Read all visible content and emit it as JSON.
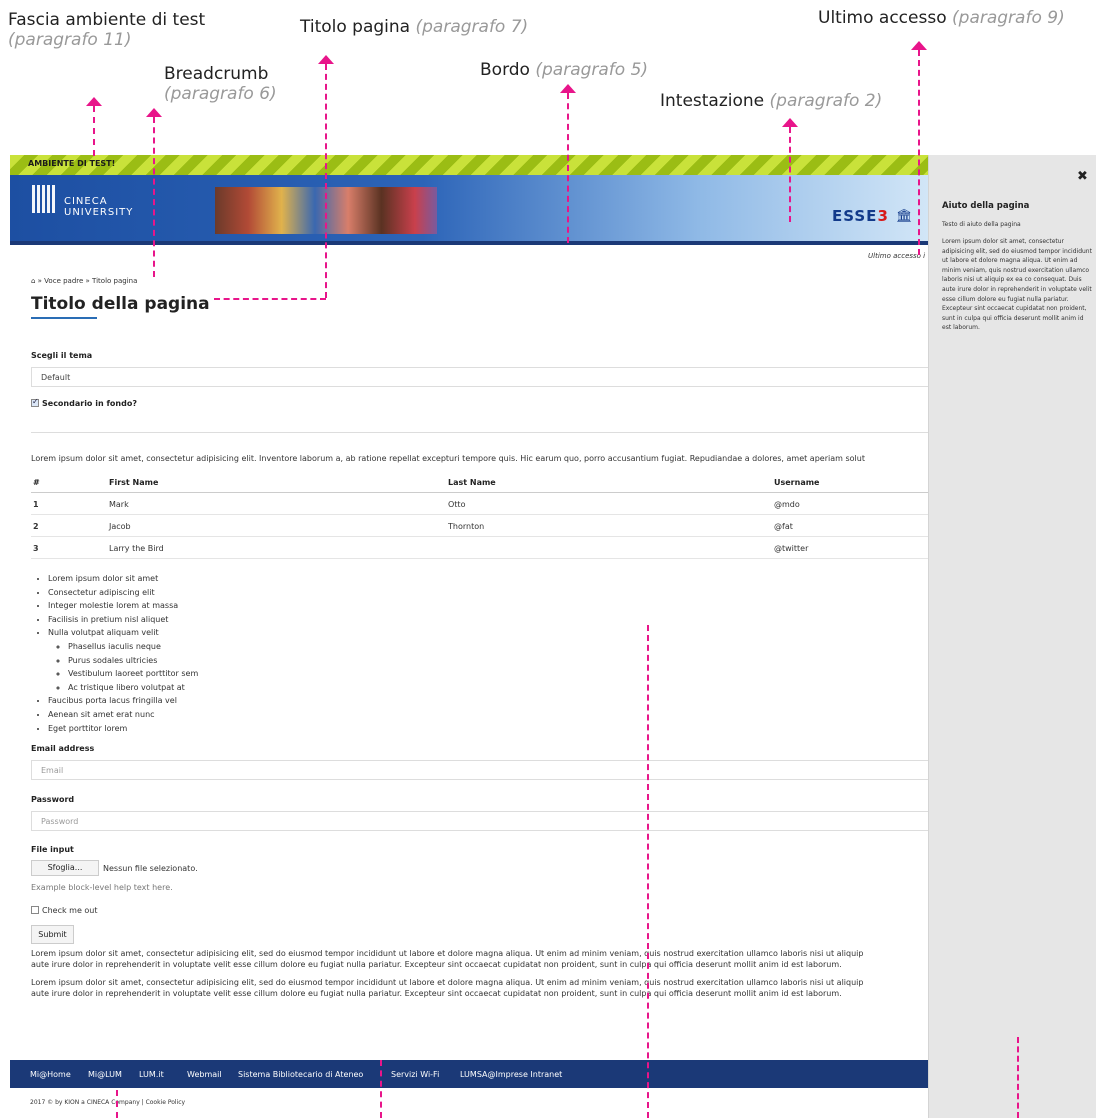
{
  "annotations": {
    "fascia": {
      "main": "Fascia ambiente di test",
      "para": "(paragrafo 11)"
    },
    "titolo": {
      "main": "Titolo pagina ",
      "para": "(paragrafo 7)"
    },
    "ultimo": {
      "main": "Ultimo accesso ",
      "para": "(paragrafo 9)"
    },
    "breadcrumb": {
      "main": "Breadcrumb",
      "para": "(paragrafo 6)"
    },
    "bordo": {
      "main": "Bordo ",
      "para": "(paragrafo 5)"
    },
    "intestazione": {
      "main": "Intestazione ",
      "para": "(paragrafo 2)"
    }
  },
  "testband": {
    "label": "AMBIENTE DI TEST!"
  },
  "header": {
    "logo_line1": "CINECA",
    "logo_line2": "UNIVERSITY",
    "brand_pre": "ESSE",
    "brand_num": "3"
  },
  "last_access": "Ultimo accesso i",
  "breadcrumb": {
    "home_icon": "home-icon",
    "text": " » Voce padre » Titolo pagina"
  },
  "page_title": "Titolo della pagina",
  "theme": {
    "label": "Scegli il tema",
    "value": "Default"
  },
  "secondary": {
    "label": "Secondario in fondo?",
    "checked": true
  },
  "intro": "Lorem ipsum dolor sit amet, consectetur adipisicing elit. Inventore laborum a, ab ratione repellat excepturi tempore quis. Hic earum quo, porro accusantium fugiat. Repudiandae a dolores, amet aperiam solut",
  "table": {
    "headers": [
      "#",
      "First Name",
      "Last Name",
      "Username"
    ],
    "rows": [
      [
        "1",
        "Mark",
        "Otto",
        "@mdo"
      ],
      [
        "2",
        "Jacob",
        "Thornton",
        "@fat"
      ],
      [
        "3",
        "Larry the Bird",
        "",
        "@twitter"
      ]
    ]
  },
  "list": {
    "items_before": [
      "Lorem ipsum dolor sit amet",
      "Consectetur adipiscing elit",
      "Integer molestie lorem at massa",
      "Facilisis in pretium nisl aliquet",
      "Nulla volutpat aliquam velit"
    ],
    "nested": [
      "Phasellus iaculis neque",
      "Purus sodales ultricies",
      "Vestibulum laoreet porttitor sem",
      "Ac tristique libero volutpat at"
    ],
    "items_after": [
      "Faucibus porta lacus fringilla vel",
      "Aenean sit amet erat nunc",
      "Eget porttitor lorem"
    ]
  },
  "form": {
    "email_label": "Email address",
    "email_placeholder": "Email",
    "password_label": "Password",
    "password_placeholder": "Password",
    "file_label": "File input",
    "file_button": "Sfoglia...",
    "file_status": "Nessun file selezionato.",
    "help_text": "Example block-level help text here.",
    "check_label": "Check me out",
    "submit": "Submit"
  },
  "paragraphs": {
    "p1_l1": "Lorem ipsum dolor sit amet, consectetur adipisicing elit, sed do eiusmod tempor incididunt ut labore et dolore magna aliqua. Ut enim ad minim veniam, quis nostrud exercitation ullamco laboris nisi ut aliquip",
    "p1_l2": "aute irure dolor in reprehenderit in voluptate velit esse cillum dolore eu fugiat nulla pariatur. Excepteur sint occaecat cupidatat non proident, sunt in culpa qui officia deserunt mollit anim id est laborum.",
    "p2_l1": "Lorem ipsum dolor sit amet, consectetur adipisicing elit, sed do eiusmod tempor incididunt ut labore et dolore magna aliqua. Ut enim ad minim veniam, quis nostrud exercitation ullamco laboris nisi ut aliquip",
    "p2_l2": "aute irure dolor in reprehenderit in voluptate velit esse cillum dolore eu fugiat nulla pariatur. Excepteur sint occaecat cupidatat non proident, sunt in culpa qui officia deserunt mollit anim id est laborum."
  },
  "footer": {
    "links": [
      "Mi@Home",
      "Mi@LUM",
      "LUM.it",
      "Webmail",
      "Sistema Bibliotecario di Ateneo",
      "Servizi Wi-Fi",
      "LUMSA@Imprese Intranet"
    ],
    "copyright": "2017 © by KION a CINECA Company | Cookie Policy"
  },
  "help": {
    "close_icon": "close-icon",
    "title": "Aiuto della pagina",
    "subtitle": "Testo di aiuto della pagina",
    "text": "Lorem ipsum dolor sit amet, consectetur adipisicing elit, sed do eiusmod tempor incididunt ut labore et dolore magna aliqua. Ut enim ad minim veniam, quis nostrud exercitation ullamco laboris nisi ut aliquip ex ea co consequat. Duis aute irure dolor in reprehenderit in voluptate velit esse cillum dolore eu fugiat nulla pariatur. Excepteur sint occaecat cupidatat non proident, sunt in culpa qui officia deserunt mollit anim id est laborum."
  },
  "colors": {
    "accent": "#e8158a",
    "header_dark": "#1b3977",
    "test_band": "#9bbd14"
  }
}
